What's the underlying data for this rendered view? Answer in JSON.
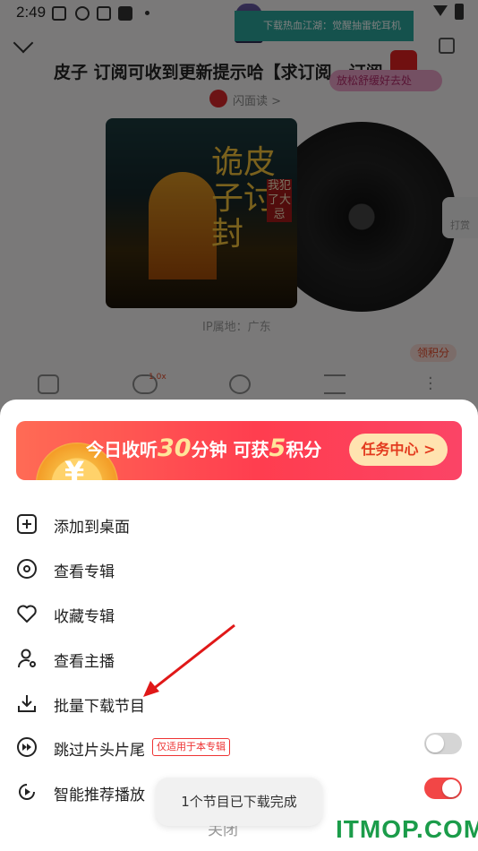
{
  "status_bar": {
    "time": "2:49"
  },
  "ad_banner": {
    "text": "下载热血江湖：觉醒抽雷蛇耳机"
  },
  "player": {
    "track_title": "皮子 订阅可收到更新提示哈【求订阅，订阅",
    "author_name": "闪面读 >",
    "relax_chip": "放松舒缓好去处",
    "cover_title": "诡皮子讨封",
    "cover_subtitle": "我犯了大忌",
    "ip_location": "IP属地：广东",
    "points_chip": "领积分",
    "tip_label": "打赏",
    "speed_badge": "1.0x"
  },
  "promo": {
    "text_before": "今日收听",
    "minutes": "30",
    "text_mid": "分钟 可获",
    "points": "5",
    "text_after": "积分",
    "button_label": "任务中心 >",
    "coin_symbol": "¥"
  },
  "menu": {
    "items": [
      {
        "label": "添加到桌面",
        "icon": "add-square-icon"
      },
      {
        "label": "查看专辑",
        "icon": "disc-icon"
      },
      {
        "label": "收藏专辑",
        "icon": "heart-icon"
      },
      {
        "label": "查看主播",
        "icon": "user-icon"
      },
      {
        "label": "批量下载节目",
        "icon": "download-icon"
      },
      {
        "label": "跳过片头片尾",
        "icon": "skip-icon",
        "tag": "仅适用于本专辑",
        "toggle_on": false
      },
      {
        "label": "智能推荐播放",
        "icon": "smart-play-icon",
        "toggle_on": true
      }
    ],
    "close_label": "关闭"
  },
  "toast": {
    "text": "1个节目已下载完成"
  },
  "watermark": {
    "text": "ITMOP.COM"
  },
  "colors": {
    "accent_red": "#ff3d4f",
    "toggle_off": "#d5d5d5",
    "toggle_on": "#f24646",
    "arrow": "#e01818",
    "watermark": "#1b9c4a"
  }
}
